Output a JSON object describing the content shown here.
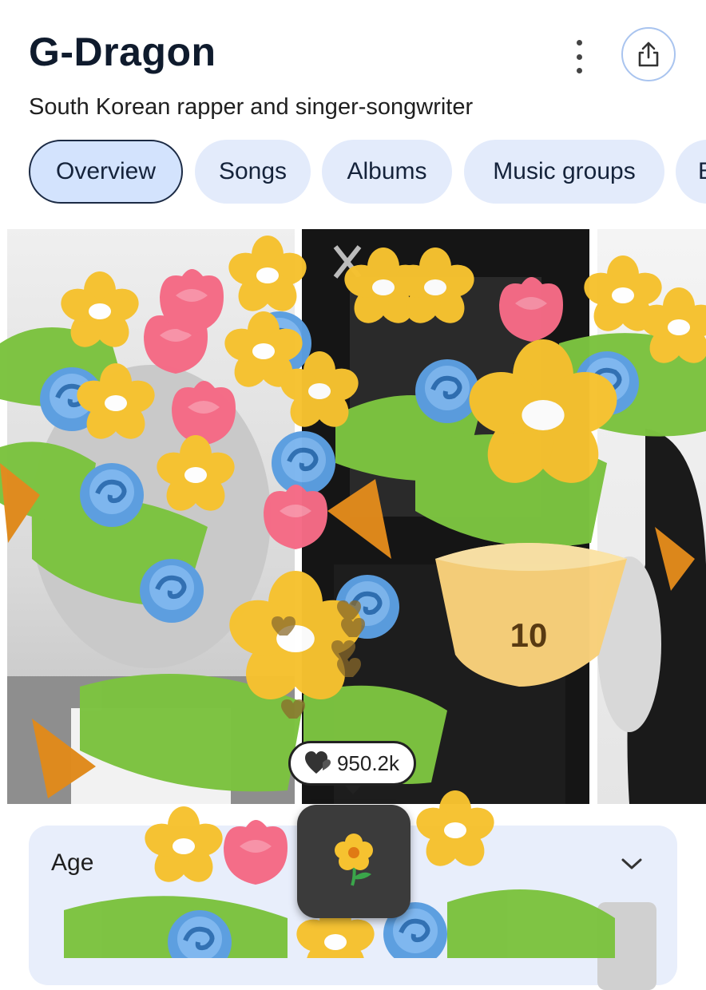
{
  "header": {
    "title": "G-Dragon",
    "subtitle": "South Korean rapper and singer-songwriter",
    "more_icon": "more-vert-icon",
    "share_icon": "share-icon"
  },
  "tabs": [
    {
      "label": "Overview",
      "active": true
    },
    {
      "label": "Songs",
      "active": false
    },
    {
      "label": "Albums",
      "active": false
    },
    {
      "label": "Music groups",
      "active": false
    },
    {
      "label": "B",
      "active": false
    }
  ],
  "info_card": {
    "label": "Age",
    "chevron_icon": "chevron-down-icon"
  },
  "reaction": {
    "bouquet_count": "10",
    "likes_count": "950.2k",
    "heart_icon": "hearts-icon",
    "button_icon": "flower-icon"
  },
  "colors": {
    "chip_bg": "#e3ebfb",
    "chip_active_bg": "#d3e3fd",
    "title": "#0f1b2d",
    "flower_yellow": "#f6c230",
    "flower_pink": "#f56b86",
    "flower_blue": "#5b9ee0",
    "leaf_green": "#7cc340"
  }
}
